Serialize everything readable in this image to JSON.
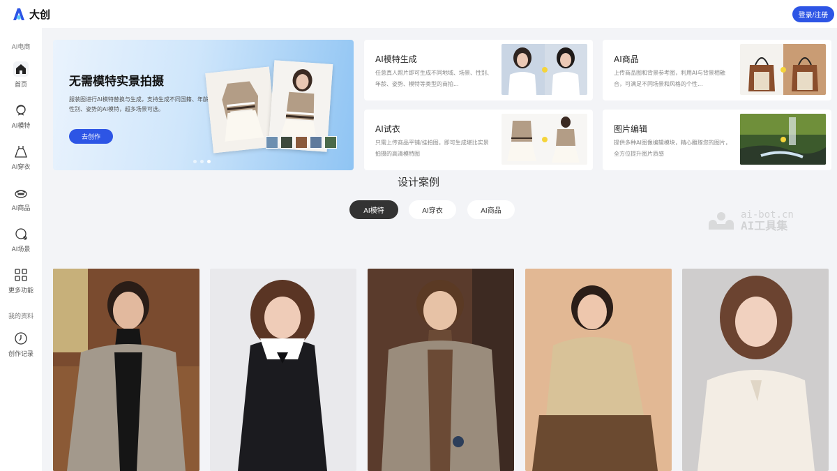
{
  "app": {
    "logo_text": "大创",
    "login_label": "登录/注册"
  },
  "sidebar": {
    "section_ai": "AI电商",
    "items": [
      {
        "label": "首页",
        "icon": "home-icon"
      },
      {
        "label": "AI模特",
        "icon": "model-face-icon"
      },
      {
        "label": "AI穿衣",
        "icon": "dress-icon"
      },
      {
        "label": "AI商品",
        "icon": "product-icon"
      },
      {
        "label": "AI场景",
        "icon": "scene-icon"
      },
      {
        "label": "更多功能",
        "icon": "grid-icon"
      }
    ],
    "section_mine": "我的资料",
    "history": {
      "label": "创作记录",
      "icon": "clock-icon"
    }
  },
  "hero": {
    "title": "无需模特实景拍摄",
    "desc": "服装图进行AI模特替换与生成，支持生成不同国籍、年龄、性别、姿势的AI模特，超多场景可选。",
    "button": "去创作"
  },
  "features": [
    {
      "title": "AI模特生成",
      "desc": "任意真人照片即可生成不同地域、场景、性别、年龄、姿势、模特等类型的商拍..."
    },
    {
      "title": "AI商品",
      "desc": "上传商品图和背景参考图，利用AI与背景相融合，可满足不同场景和风格的个性..."
    },
    {
      "title": "AI试衣",
      "desc": "只需上传商品平铺/挂拍图，即可生成堪比实景拍摄的高清模特图"
    },
    {
      "title": "图片编辑",
      "desc": "提供多种AI图像编辑模块，精心雕琢您的图片，全方位提升图片质感"
    }
  ],
  "cases": {
    "title": "设计案例",
    "tabs": [
      "AI模特",
      "AI穿衣",
      "AI商品"
    ],
    "active_tab": "AI模特"
  },
  "watermark": {
    "line1": "ai-bot.cn",
    "line2": "AI工具集"
  },
  "colors": {
    "accent": "#2d55e5",
    "dark_tab": "#333333",
    "bg": "#f3f4f7"
  }
}
